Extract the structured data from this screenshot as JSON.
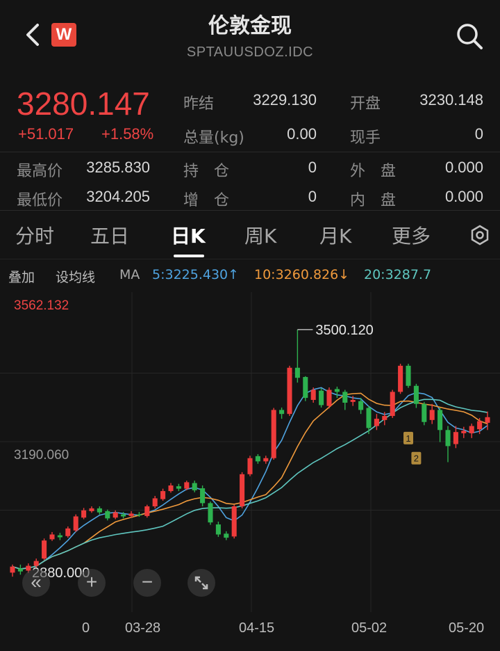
{
  "header": {
    "title": "伦敦金现",
    "subtitle": "SPTAUUSDOZ.IDC",
    "logo_letter": "W"
  },
  "quote": {
    "price": "3280.147",
    "change": "+51.017",
    "change_pct": "+1.58%",
    "fields": [
      {
        "label": "昨结",
        "value": "3229.130"
      },
      {
        "label": "开盘",
        "value": "3230.148"
      },
      {
        "label": "总量(kg)",
        "value": "0.00"
      },
      {
        "label": "现手",
        "value": "0"
      },
      {
        "label": "最高价",
        "value": "3285.830"
      },
      {
        "label": "持　仓",
        "value": "0"
      },
      {
        "label": "外　盘",
        "value": "0.000"
      },
      {
        "label": "最低价",
        "value": "3204.205"
      },
      {
        "label": "增　仓",
        "value": "0"
      },
      {
        "label": "内　盘",
        "value": "0.000"
      }
    ]
  },
  "tabs": [
    "分时",
    "五日",
    "日K",
    "周K",
    "月K",
    "更多"
  ],
  "active_tab": "日K",
  "ma_bar": {
    "overlay_label": "叠加",
    "set_ma_label": "设均线",
    "ma_label": "MA",
    "ma5": "5:3225.430↑",
    "ma10": "10:3260.826↓",
    "ma20": "20:3287.7",
    "colors": {
      "ma5": "#4fa3e0",
      "ma10": "#f09a3c",
      "ma20": "#5fc7c0"
    }
  },
  "chart_data": {
    "type": "candlestick",
    "y_top_label": "3562.132",
    "y_mid_label": "3190.060",
    "y_bottom_label": "2880.000",
    "high_annotation": "3500.120",
    "ylim": [
      2880,
      3562.132
    ],
    "x_tick_labels": [
      "0",
      "03-28",
      "04-15",
      "05-02",
      "05-20"
    ],
    "markers": [
      "1",
      "2"
    ],
    "colors": {
      "up": "#ee3b3b",
      "down": "#2db24f"
    },
    "candles": [
      [
        2895,
        2910,
        2885,
        2915
      ],
      [
        2905,
        2898,
        2890,
        2915
      ],
      [
        2900,
        2912,
        2894,
        2918
      ],
      [
        2912,
        2924,
        2906,
        2930
      ],
      [
        2930,
        2975,
        2926,
        2980
      ],
      [
        2978,
        2990,
        2974,
        2996
      ],
      [
        2988,
        2983,
        2976,
        2994
      ],
      [
        2986,
        3005,
        2982,
        3010
      ],
      [
        3000,
        3035,
        2996,
        3040
      ],
      [
        3032,
        3050,
        3028,
        3056
      ],
      [
        3048,
        3055,
        3044,
        3060
      ],
      [
        3055,
        3045,
        3040,
        3060
      ],
      [
        3048,
        3030,
        3025,
        3052
      ],
      [
        3032,
        3045,
        3028,
        3050
      ],
      [
        3040,
        3035,
        3030,
        3046
      ],
      [
        3036,
        3042,
        3032,
        3048
      ],
      [
        3040,
        3038,
        3034,
        3046
      ],
      [
        3036,
        3060,
        3032,
        3064
      ],
      [
        3060,
        3080,
        3055,
        3086
      ],
      [
        3078,
        3098,
        3074,
        3104
      ],
      [
        3098,
        3112,
        3094,
        3118
      ],
      [
        3110,
        3104,
        3098,
        3116
      ],
      [
        3104,
        3120,
        3100,
        3124
      ],
      [
        3118,
        3100,
        3095,
        3124
      ],
      [
        3105,
        3068,
        3060,
        3112
      ],
      [
        3068,
        3020,
        3014,
        3072
      ],
      [
        3015,
        2990,
        2984,
        3022
      ],
      [
        2992,
        2982,
        2976,
        2998
      ],
      [
        2985,
        3060,
        2980,
        3064
      ],
      [
        3060,
        3140,
        3055,
        3145
      ],
      [
        3140,
        3180,
        3135,
        3186
      ],
      [
        3185,
        3172,
        3166,
        3190
      ],
      [
        3172,
        3180,
        3166,
        3186
      ],
      [
        3180,
        3300,
        3176,
        3305
      ],
      [
        3300,
        3290,
        3278,
        3306
      ],
      [
        3290,
        3405,
        3285,
        3410
      ],
      [
        3405,
        3380,
        3368,
        3500
      ],
      [
        3382,
        3330,
        3322,
        3384
      ],
      [
        3325,
        3350,
        3318,
        3356
      ],
      [
        3348,
        3312,
        3306,
        3354
      ],
      [
        3310,
        3350,
        3304,
        3356
      ],
      [
        3352,
        3345,
        3330,
        3358
      ],
      [
        3345,
        3318,
        3300,
        3350
      ],
      [
        3320,
        3325,
        3310,
        3335
      ],
      [
        3322,
        3300,
        3290,
        3330
      ],
      [
        3305,
        3255,
        3240,
        3310
      ],
      [
        3260,
        3278,
        3250,
        3290
      ],
      [
        3275,
        3285,
        3262,
        3295
      ],
      [
        3285,
        3345,
        3280,
        3350
      ],
      [
        3345,
        3410,
        3340,
        3415
      ],
      [
        3410,
        3360,
        3355,
        3415
      ],
      [
        3360,
        3315,
        3305,
        3365
      ],
      [
        3315,
        3270,
        3262,
        3320
      ],
      [
        3275,
        3300,
        3265,
        3315
      ],
      [
        3300,
        3250,
        3220,
        3305
      ],
      [
        3250,
        3210,
        3170,
        3260
      ],
      [
        3215,
        3245,
        3205,
        3260
      ],
      [
        3242,
        3248,
        3230,
        3258
      ],
      [
        3242,
        3260,
        3230,
        3266
      ],
      [
        3252,
        3272,
        3240,
        3280
      ],
      [
        3268,
        3282,
        3250,
        3296
      ]
    ]
  }
}
